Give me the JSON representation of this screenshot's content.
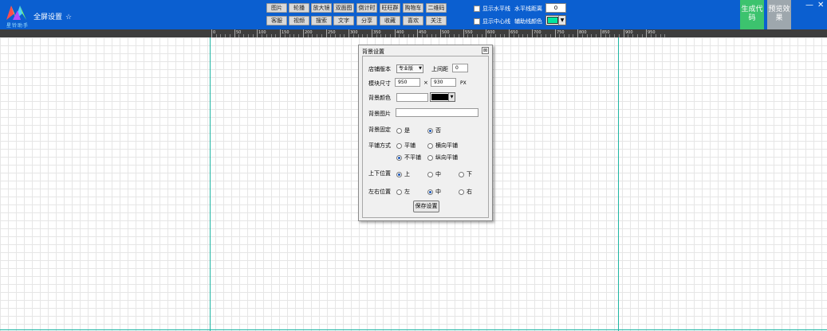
{
  "app": {
    "logo_text": "星铃助手",
    "title": "全屏设置",
    "star": "☆"
  },
  "toolbar": {
    "row1": [
      "图片",
      "轮播",
      "放大镜",
      "双面图",
      "倒计时",
      "旺旺群",
      "购物车",
      "二维码"
    ],
    "row2": [
      "客服",
      "视频",
      "搜索",
      "文字",
      "分享",
      "收藏",
      "喜欢",
      "关注"
    ],
    "show_horizontal": "显示水平线",
    "show_center": "显示中心线",
    "h_distance_label": "水平线距离",
    "h_distance_value": "0",
    "aux_color_label": "辅助线颜色",
    "aux_color": "#00e6a0",
    "generate_label": "生成代码",
    "preview_label": "预览效果",
    "minimize": "—",
    "close": "✕"
  },
  "ruler": {
    "labels": [
      "0",
      "50",
      "100",
      "150",
      "200",
      "250",
      "300",
      "350",
      "400",
      "450",
      "500",
      "550",
      "600",
      "650",
      "700",
      "750",
      "800",
      "850",
      "900",
      "950"
    ]
  },
  "dialog": {
    "title": "背景设置",
    "close": "⊠",
    "version_label": "店铺版本",
    "version_value": "专业版",
    "margin_top_label": "上间距",
    "margin_top_value": "0",
    "size_label": "模块尺寸",
    "width_value": "950",
    "times": "×",
    "height_value": "930",
    "unit": "PX",
    "bg_color_label": "背景颜色",
    "bg_color": "#000000",
    "bg_image_label": "背景图片",
    "bg_image_value": "",
    "fixed_label": "背景固定",
    "fixed_yes": "是",
    "fixed_no": "否",
    "tile_label": "平铺方式",
    "tile_both": "平铺",
    "tile_h": "横向平铺",
    "tile_none": "不平铺",
    "tile_v": "纵向平铺",
    "vpos_label": "上下位置",
    "vpos_top": "上",
    "vpos_mid": "中",
    "vpos_bottom": "下",
    "hpos_label": "左右位置",
    "hpos_left": "左",
    "hpos_mid": "中",
    "hpos_right": "右",
    "save_label": "保存设置"
  }
}
